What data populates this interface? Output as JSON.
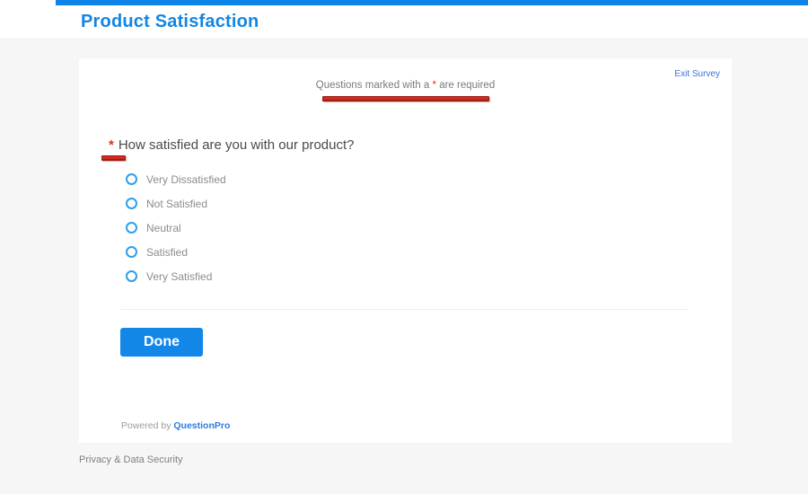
{
  "header": {
    "title": "Product Satisfaction"
  },
  "survey": {
    "exit_link_label": "Exit Survey",
    "required_note": {
      "prefix": "Questions marked with a ",
      "asterisk": "*",
      "suffix": " are required"
    },
    "question": {
      "required_marker": "*",
      "text": "How satisfied are you with our product?",
      "options": [
        "Very Dissatisfied",
        "Not Satisfied",
        "Neutral",
        "Satisfied",
        "Very Satisfied"
      ]
    },
    "done_button_label": "Done",
    "footer": {
      "powered_by_label": "Powered by ",
      "brand": "QuestionPro"
    }
  },
  "page_footer": {
    "privacy_link_label": "Privacy & Data Security"
  },
  "colors": {
    "top_bar_blue": "#0d84e8",
    "title_blue": "#1385e3",
    "exit_link_blue": "#3c70d6",
    "done_button_blue": "#1287e8",
    "radio_border_blue": "#2d9fe8",
    "annotation_red": "#d22c21",
    "page_background": "#f6f6f6"
  },
  "annotations": {
    "note_underline": "red marker under required note",
    "question_underline": "red marker under question asterisk"
  }
}
